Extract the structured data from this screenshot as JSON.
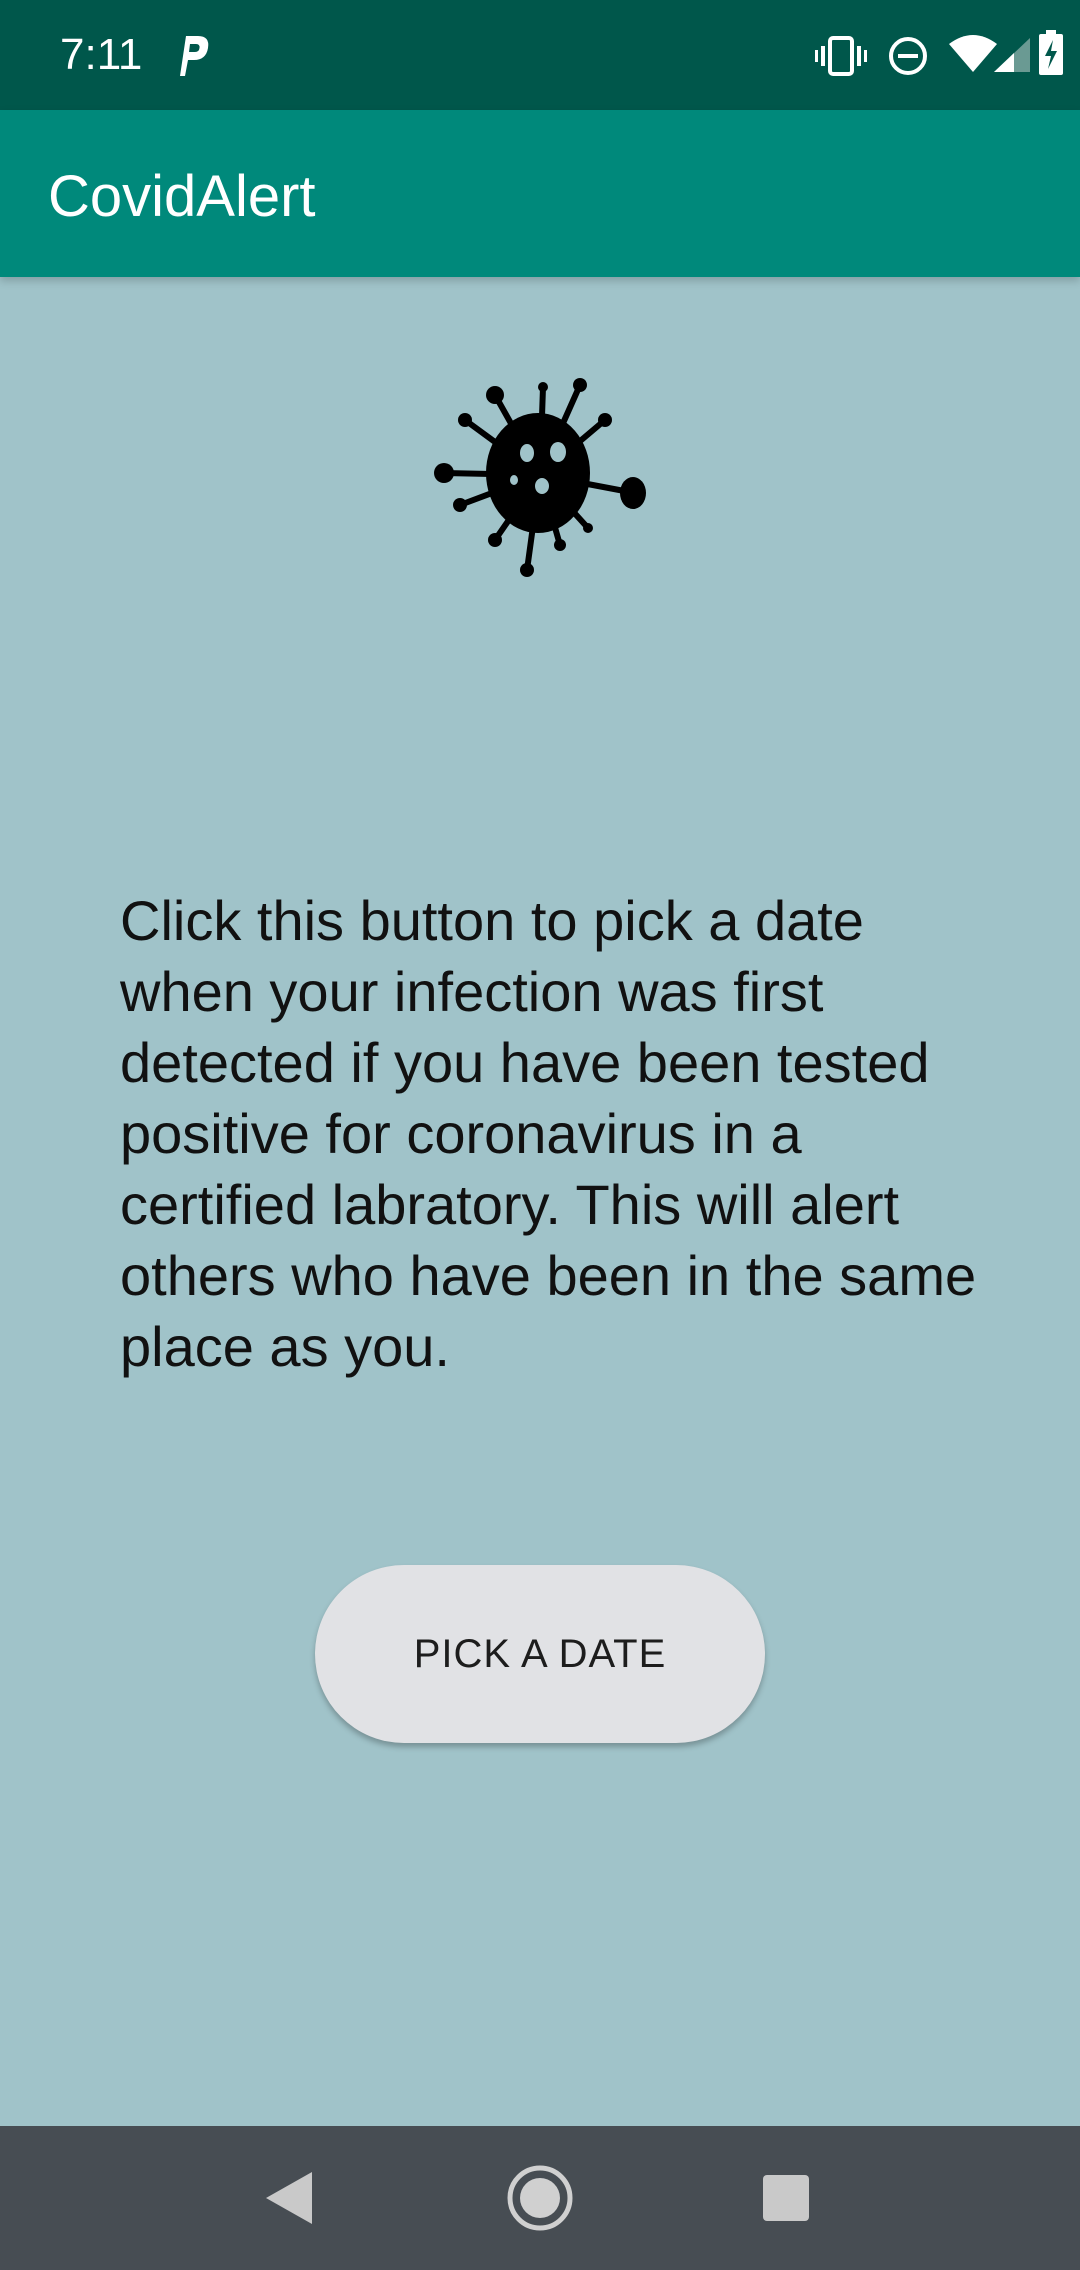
{
  "status_bar": {
    "time": "7:11",
    "icons": [
      "parking-notification-icon",
      "vibrate-icon",
      "do-not-disturb-icon",
      "wifi-icon",
      "cell-signal-icon",
      "battery-charging-icon"
    ]
  },
  "app_bar": {
    "title": "CovidAlert"
  },
  "main": {
    "illustration": "virus-icon",
    "message": "Click this button to pick a date when your infection was first detected if you have been tested positive for coronavirus in a certified labratory. This will alert others who have been in the same place as you.",
    "pick_button_label": "PICK A DATE"
  },
  "nav_bar": {
    "icons": [
      "back-icon",
      "home-icon",
      "recents-icon"
    ]
  },
  "colors": {
    "status_bar": "#00574b",
    "app_bar": "#00897b",
    "background": "#a0c3c9",
    "button": "#e1e2e5",
    "nav_bar": "#474d53"
  }
}
